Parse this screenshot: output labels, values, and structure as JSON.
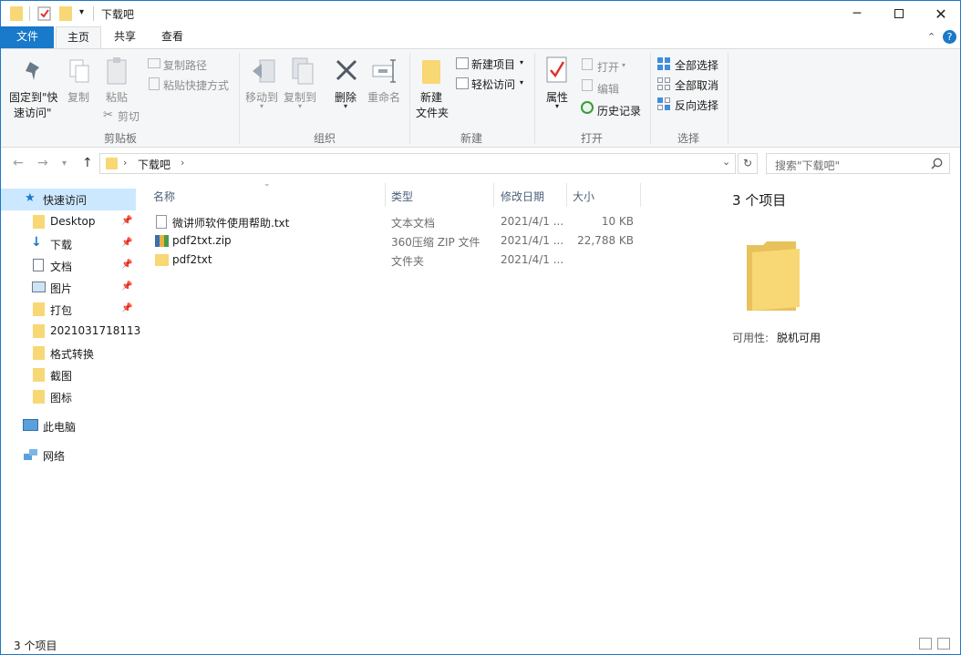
{
  "window": {
    "title": "下载吧",
    "colors": {
      "accent": "#1979ca",
      "selection": "#cce8ff",
      "folder": "#f8d775"
    }
  },
  "tabs": [
    {
      "label": "文件"
    },
    {
      "label": "主页"
    },
    {
      "label": "共享"
    },
    {
      "label": "查看"
    }
  ],
  "ribbon": {
    "clipboard": {
      "pin": "固定到\"快",
      "pin2": "速访问\"",
      "copy": "复制",
      "paste": "粘贴",
      "copy_path": "复制路径",
      "paste_shortcut": "粘贴快捷方式",
      "cut": "剪切",
      "label": "剪贴板"
    },
    "organize": {
      "move_to": "移动到",
      "copy_to": "复制到",
      "delete": "删除",
      "rename": "重命名",
      "label": "组织"
    },
    "new": {
      "new_folder": "新建",
      "new_folder2": "文件夹",
      "new_item": "新建项目",
      "easy_access": "轻松访问",
      "label": "新建"
    },
    "open": {
      "properties": "属性",
      "open": "打开",
      "edit": "编辑",
      "history": "历史记录",
      "label": "打开"
    },
    "select": {
      "select_all": "全部选择",
      "select_none": "全部取消",
      "invert": "反向选择",
      "label": "选择"
    }
  },
  "address": {
    "path": "下载吧",
    "search_placeholder": "搜索\"下载吧\""
  },
  "nav": {
    "quick_access": "快速访问",
    "items": [
      {
        "label": "Desktop",
        "pinned": true
      },
      {
        "label": "下载",
        "pinned": true
      },
      {
        "label": "文档",
        "pinned": true
      },
      {
        "label": "图片",
        "pinned": true
      },
      {
        "label": "打包",
        "pinned": true
      },
      {
        "label": "2021031718113",
        "pinned": false
      },
      {
        "label": "格式转换",
        "pinned": false
      },
      {
        "label": "截图",
        "pinned": false
      },
      {
        "label": "图标",
        "pinned": false
      }
    ],
    "this_pc": "此电脑",
    "network": "网络"
  },
  "list": {
    "headers": {
      "name": "名称",
      "type": "类型",
      "date": "修改日期",
      "size": "大小"
    },
    "files": [
      {
        "name": "微讲师软件使用帮助.txt",
        "type": "文本文档",
        "date": "2021/4/1 ...",
        "size": "10 KB",
        "icon": "text-file-icon"
      },
      {
        "name": "pdf2txt.zip",
        "type": "360压缩 ZIP 文件",
        "date": "2021/4/1 ...",
        "size": "22,788 KB",
        "icon": "zip-file-icon"
      },
      {
        "name": "pdf2txt",
        "type": "文件夹",
        "date": "2021/4/1 ...",
        "size": "",
        "icon": "folder-icon"
      }
    ]
  },
  "preview": {
    "count": "3 个项目",
    "availability_label": "可用性:",
    "availability_value": "脱机可用"
  },
  "status": {
    "count": "3 个项目"
  }
}
